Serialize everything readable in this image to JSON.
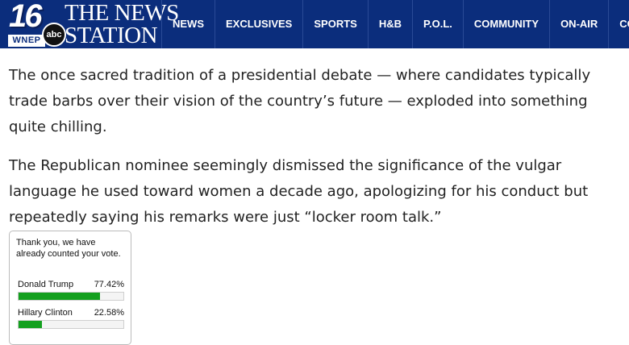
{
  "header": {
    "logo": {
      "channel_number": "16",
      "call_sign": "WNEP",
      "network": "abc",
      "name_line1": "THE NEWS",
      "name_line2": "STATION"
    },
    "nav": [
      "NEWS",
      "EXCLUSIVES",
      "SPORTS",
      "H&B",
      "P.O.L.",
      "COMMUNITY",
      "ON-AIR",
      "CONTE"
    ],
    "colors": {
      "background": "#0b2d7c",
      "text": "#ffffff"
    }
  },
  "article": {
    "paragraphs": [
      "The once sacred tradition of a presidential debate — where candidates typically trade barbs over their vision of the country’s future — exploded into something quite chilling.",
      "The Republican nominee seemingly dismissed the significance of the vulgar language he used toward women a decade ago, apologizing for his conduct but repeatedly saying his remarks were just “locker room talk.”"
    ]
  },
  "poll": {
    "message": "Thank you, we have already counted your vote.",
    "options": [
      {
        "name": "Donald Trump",
        "percent_label": "77.42%",
        "percent": 77.42
      },
      {
        "name": "Hillary Clinton",
        "percent_label": "22.58%",
        "percent": 22.58
      }
    ],
    "bar_color": "#14a01f"
  }
}
